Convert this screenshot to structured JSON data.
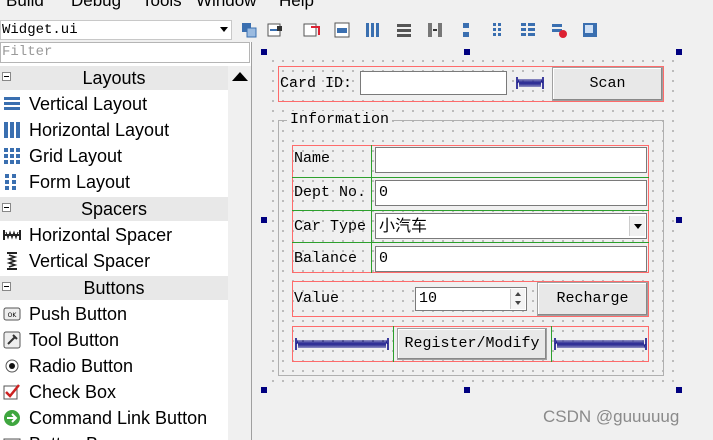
{
  "menubar": {
    "items": [
      "Build",
      "Debug",
      "Tools",
      "Window",
      "Help"
    ]
  },
  "toolbar": {
    "form_selector": "Widget.ui",
    "buttons": [
      "edit-widgets-icon",
      "edit-signals-slots-icon",
      "edit-buddies-icon",
      "edit-tab-order-icon",
      "layout-horizontal-icon",
      "layout-vertical-icon",
      "layout-horizontal-splitter-icon",
      "layout-vertical-splitter-icon",
      "layout-grid-icon",
      "layout-form-icon",
      "break-layout-icon",
      "adjust-size-icon"
    ]
  },
  "widget_box": {
    "filter_placeholder": "Filter",
    "categories": [
      {
        "label": "Layouts",
        "items": [
          {
            "label": "Vertical Layout",
            "icon": "vertical-layout-icon"
          },
          {
            "label": "Horizontal Layout",
            "icon": "horizontal-layout-icon"
          },
          {
            "label": "Grid Layout",
            "icon": "grid-layout-icon"
          },
          {
            "label": "Form Layout",
            "icon": "form-layout-icon"
          }
        ]
      },
      {
        "label": "Spacers",
        "items": [
          {
            "label": "Horizontal Spacer",
            "icon": "horizontal-spacer-icon"
          },
          {
            "label": "Vertical Spacer",
            "icon": "vertical-spacer-icon"
          }
        ]
      },
      {
        "label": "Buttons",
        "items": [
          {
            "label": "Push Button",
            "icon": "push-button-icon"
          },
          {
            "label": "Tool Button",
            "icon": "tool-button-icon"
          },
          {
            "label": "Radio Button",
            "icon": "radio-button-icon"
          },
          {
            "label": "Check Box",
            "icon": "check-box-icon"
          },
          {
            "label": "Command Link Button",
            "icon": "command-link-icon"
          },
          {
            "label": "Button Box",
            "icon": "button-box-icon"
          }
        ]
      }
    ]
  },
  "form": {
    "card_id_label": "Card ID:",
    "card_id_value": "",
    "scan_label": "Scan",
    "group_title": "Information",
    "name_label": "Name",
    "name_value": "",
    "dept_label": "Dept No.",
    "dept_value": "0",
    "car_type_label": "Car Type",
    "car_type_value": "小汽车",
    "balance_label": "Balance",
    "balance_value": "0",
    "value_label": "Value",
    "value_spin": "10",
    "recharge_label": "Recharge",
    "register_label": "Register/Modify"
  },
  "watermark": "CSDN @guuuuug",
  "colors": {
    "layout_outline": "#ff6b6b",
    "selection_handle": "#000080",
    "category_bg": "#e8e8e8"
  }
}
